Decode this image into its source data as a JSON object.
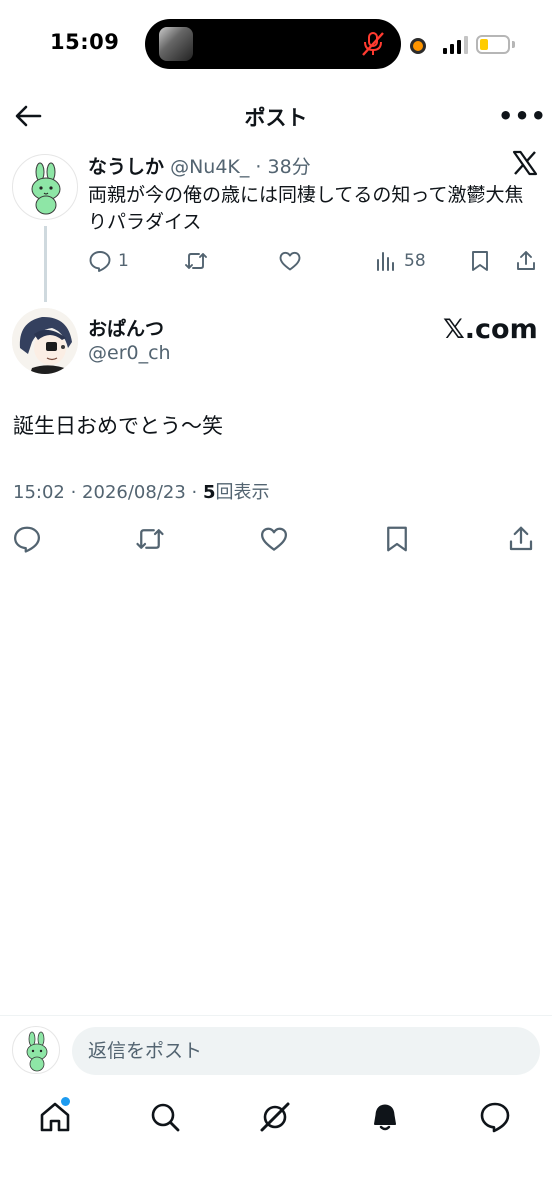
{
  "status_bar": {
    "time": "15:09",
    "island_icon": "mic-muted-icon",
    "recording_color": "#ff9500",
    "battery_color": "#ffcc00"
  },
  "header": {
    "title": "ポスト",
    "back_icon": "arrow-left-icon",
    "more_icon": "more-dots-icon",
    "more_label": "•••"
  },
  "quoted_post": {
    "name": "なうしか",
    "handle": "@Nu4K_",
    "separator": "·",
    "time": "38分",
    "text": "両親が今の俺の歳には同棲してるの知って激鬱大焦りパラダイス",
    "replies": "1",
    "views": "58",
    "platform_icon": "x-logo-icon"
  },
  "main_post": {
    "name": "おぱんつ",
    "handle": "@er0_ch",
    "brand": "𝕏.com",
    "text": "誕生日おめでとう〜笑",
    "timestamp": "15:02 · 2026/08/23 · ",
    "views_count": "5",
    "views_label": "回表示"
  },
  "reply": {
    "placeholder": "返信をポスト"
  },
  "nav": {
    "items": [
      "home-icon",
      "search-icon",
      "grok-icon",
      "notifications-icon",
      "messages-icon"
    ],
    "accent": "#1d9bf0"
  }
}
